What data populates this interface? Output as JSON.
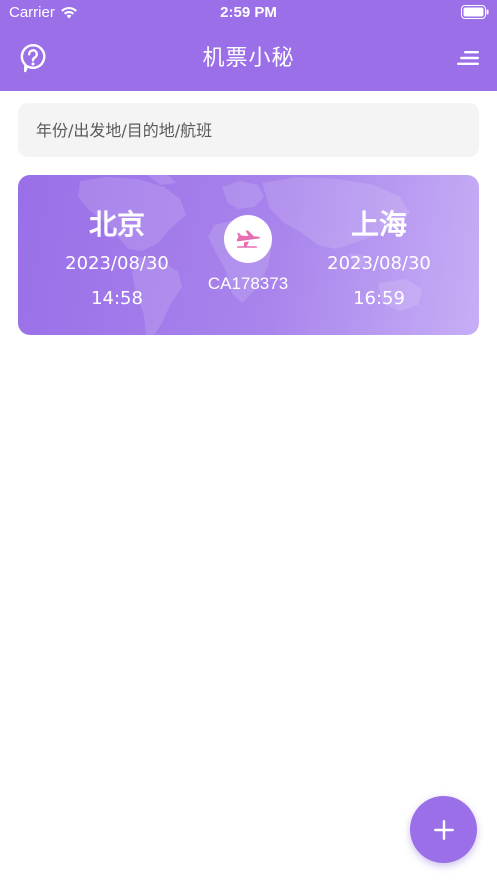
{
  "status_bar": {
    "carrier": "Carrier",
    "time": "2:59 PM"
  },
  "nav": {
    "title": "机票小秘",
    "help_icon": "question-bubble-icon",
    "menu_icon": "menu-lines-icon"
  },
  "search": {
    "placeholder": "年份/出发地/目的地/航班",
    "value": ""
  },
  "flights": [
    {
      "from_city": "北京",
      "from_date": "2023/08/30",
      "from_time": "14:58",
      "to_city": "上海",
      "to_date": "2023/08/30",
      "to_time": "16:59",
      "flight_no": "CA178373"
    }
  ],
  "fab": {
    "icon": "plus-icon"
  },
  "colors": {
    "primary": "#9a6fe8",
    "plane_icon": "#e56fb0",
    "search_bg": "#f4f4f4"
  }
}
